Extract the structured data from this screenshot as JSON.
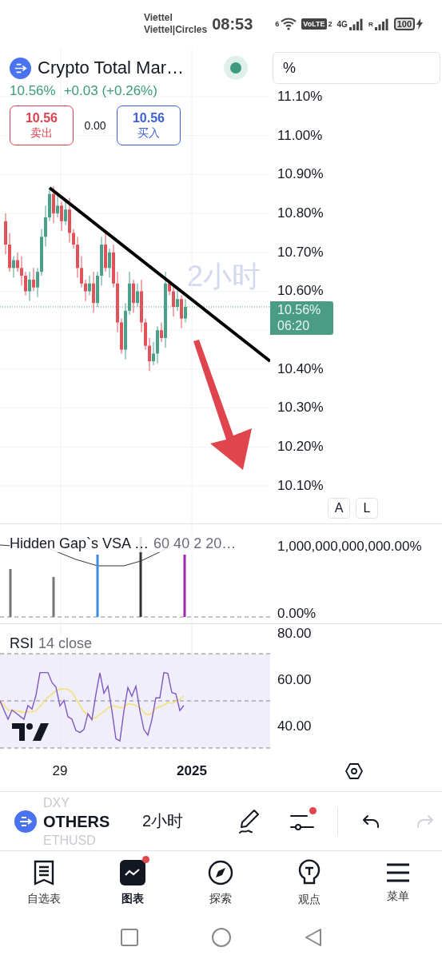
{
  "status_bar": {
    "carrier_1": "Viettel",
    "carrier_2": "Viettel|Circles",
    "time": "08:53",
    "wifi_badge": "6",
    "volte": "VoLTE",
    "sim": "2",
    "network": "4G",
    "roaming": "R",
    "battery": "100"
  },
  "header": {
    "title": "Crypto Total Mar…",
    "market_open": true,
    "scale_field": "%",
    "price": "10.56%",
    "change": "+0.03 (+0.26%)",
    "sell": {
      "price": "10.56",
      "label": "卖出"
    },
    "spread": "0.00",
    "buy": {
      "price": "10.56",
      "label": "买入"
    }
  },
  "price_pane": {
    "watermark": "2小时",
    "upper_labels": [
      "11.10%",
      "11.00%",
      "10.90%",
      "10.80%",
      "10.70%",
      "10.60%"
    ],
    "last_price": {
      "value": "10.56%",
      "countdown": "06:20"
    },
    "lower_labels": [
      "10.40%",
      "10.30%",
      "10.20%",
      "10.10%"
    ],
    "scale_buttons": [
      {
        "label": "A",
        "selected": false
      },
      {
        "label": "L",
        "selected": false
      }
    ]
  },
  "vsa_pane": {
    "title": "Hidden Gap`s VSA …",
    "params": "60 40 2 20…",
    "labels": [
      "1,000,000,000,000.00%",
      "0.00%"
    ]
  },
  "rsi_pane": {
    "title": "RSI",
    "params": "14 close",
    "labels": [
      "80.00",
      "60.00",
      "40.00"
    ]
  },
  "time_axis": {
    "labels": [
      {
        "text": "29",
        "bold": false
      },
      {
        "text": "2025",
        "bold": true
      }
    ]
  },
  "toolbar": {
    "symbol_above": "DXY",
    "symbol": "OTHERS",
    "symbol_below": "ETHUSD",
    "interval": "2小时",
    "tools": [
      {
        "kind": "pencil",
        "notification": false,
        "disabled": false
      },
      {
        "kind": "sliders",
        "notification": true,
        "disabled": false
      },
      {
        "kind": "undo",
        "notification": false,
        "disabled": false
      },
      {
        "kind": "redo",
        "notification": false,
        "disabled": true
      }
    ]
  },
  "bottom_nav": [
    {
      "kind": "watchlist",
      "label": "自选表",
      "selected": false,
      "notification": false
    },
    {
      "kind": "chart",
      "label": "图表",
      "selected": true,
      "notification": true
    },
    {
      "kind": "explore",
      "label": "探索",
      "selected": false,
      "notification": false
    },
    {
      "kind": "ideas",
      "label": "观点",
      "selected": false,
      "notification": false
    },
    {
      "kind": "menu",
      "label": "菜单",
      "selected": false,
      "notification": false
    }
  ]
}
